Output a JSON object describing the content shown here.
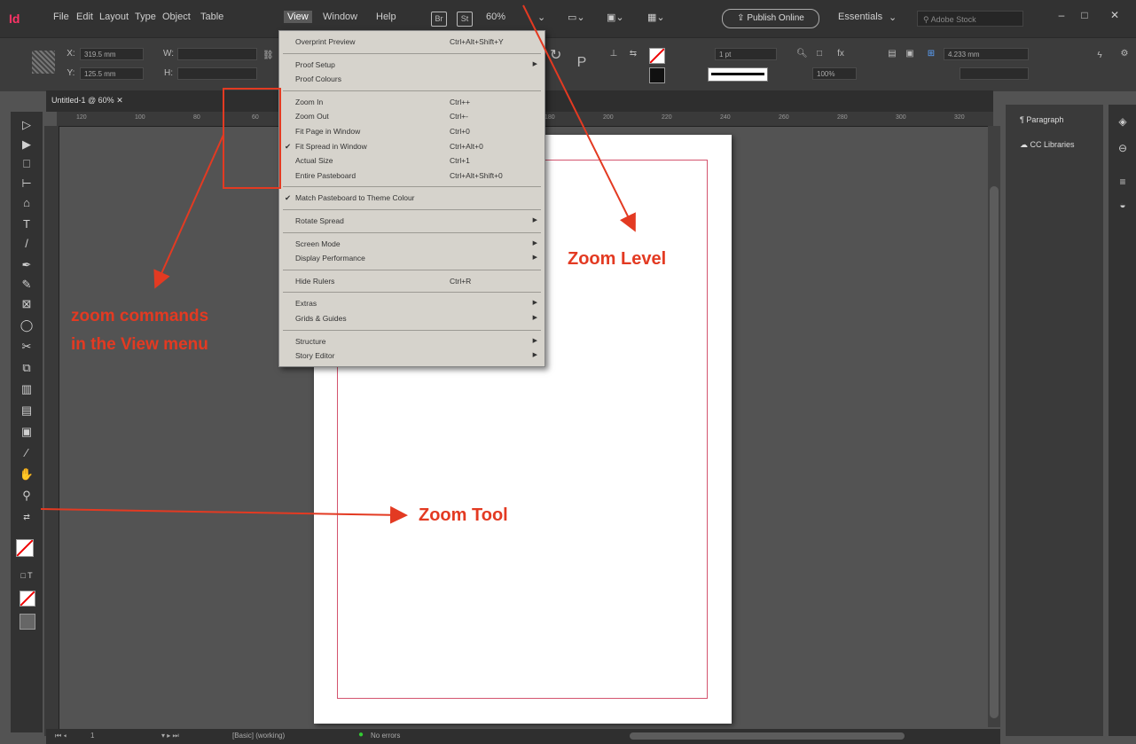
{
  "app": {
    "logo": "Id"
  },
  "menubar": {
    "items": [
      "File",
      "Edit",
      "Layout",
      "Type",
      "Object",
      "Table",
      "View",
      "Window",
      "Help"
    ],
    "zoom": "60%",
    "publish": "Publish Online",
    "workspace": "Essentials",
    "search_placeholder": "Adobe Stock"
  },
  "control": {
    "x_field": "319.5 mm",
    "y_field": "125.5 mm",
    "stroke_weight": "1 pt",
    "opacity": "100%",
    "gap": "4.233 mm"
  },
  "document": {
    "tab": "Untitled-1 @ 60%"
  },
  "ruler": {
    "h_ticks": [
      "120",
      "100",
      "80",
      "60",
      "40",
      "120",
      "140",
      "160",
      "180",
      "200",
      "220",
      "240",
      "260",
      "280",
      "300",
      "320"
    ]
  },
  "view_menu": {
    "items": [
      {
        "label": "Overprint Preview",
        "shortcut": "Ctrl+Alt+Shift+Y",
        "check": false,
        "submenu": false
      },
      {
        "sep": true
      },
      {
        "label": "Proof Setup",
        "shortcut": "",
        "check": false,
        "submenu": true
      },
      {
        "label": "Proof Colours",
        "shortcut": "",
        "check": false,
        "submenu": false
      },
      {
        "sep": true
      },
      {
        "label": "Zoom In",
        "shortcut": "Ctrl++",
        "check": false,
        "submenu": false
      },
      {
        "label": "Zoom Out",
        "shortcut": "Ctrl+-",
        "check": false,
        "submenu": false
      },
      {
        "label": "Fit Page in Window",
        "shortcut": "Ctrl+0",
        "check": false,
        "submenu": false
      },
      {
        "label": "Fit Spread in Window",
        "shortcut": "Ctrl+Alt+0",
        "check": true,
        "submenu": false
      },
      {
        "label": "Actual Size",
        "shortcut": "Ctrl+1",
        "check": false,
        "submenu": false
      },
      {
        "label": "Entire Pasteboard",
        "shortcut": "Ctrl+Alt+Shift+0",
        "check": false,
        "submenu": false
      },
      {
        "sep": true
      },
      {
        "label": "Match Pasteboard to Theme Colour",
        "shortcut": "",
        "check": true,
        "submenu": false
      },
      {
        "sep": true
      },
      {
        "label": "Rotate Spread",
        "shortcut": "",
        "check": false,
        "submenu": true
      },
      {
        "sep": true
      },
      {
        "label": "Screen Mode",
        "shortcut": "",
        "check": false,
        "submenu": true
      },
      {
        "label": "Display Performance",
        "shortcut": "",
        "check": false,
        "submenu": true
      },
      {
        "sep": true
      },
      {
        "label": "Hide Rulers",
        "shortcut": "Ctrl+R",
        "check": false,
        "submenu": false
      },
      {
        "sep": true
      },
      {
        "label": "Extras",
        "shortcut": "",
        "check": false,
        "submenu": true
      },
      {
        "label": "Grids & Guides",
        "shortcut": "",
        "check": false,
        "submenu": true
      },
      {
        "sep": true
      },
      {
        "label": "Structure",
        "shortcut": "",
        "check": false,
        "submenu": true
      },
      {
        "label": "Story Editor",
        "shortcut": "",
        "check": false,
        "submenu": true
      }
    ]
  },
  "panels": {
    "paragraph": "Paragraph",
    "cc_libraries": "CC Libraries"
  },
  "status": {
    "page": "1",
    "style": "[Basic] (working)",
    "errors": "No errors"
  },
  "annotations": {
    "zoom_commands_1": "zoom commands",
    "zoom_commands_2": "in the View menu",
    "zoom_level": "Zoom Level",
    "zoom_tool": "Zoom Tool"
  },
  "colors": {
    "annotation": "#e33a22",
    "margin": "#d4546e",
    "accent": "#ff3366"
  }
}
